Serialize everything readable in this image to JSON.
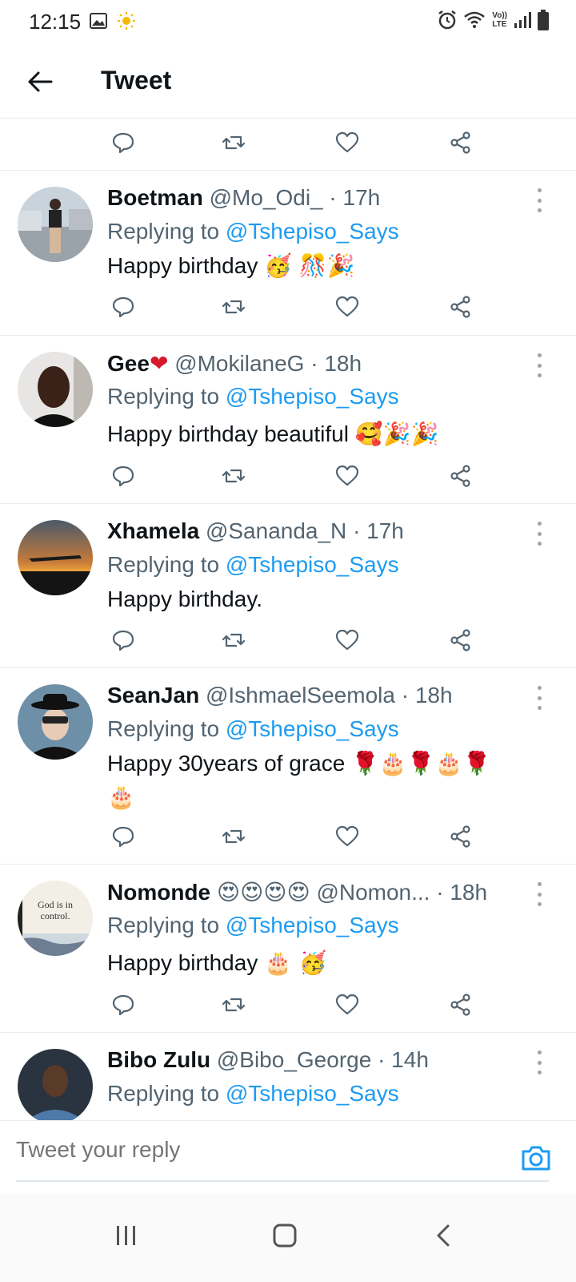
{
  "status_bar": {
    "time": "12:15",
    "left_icons": [
      "gallery-icon",
      "sun-icon"
    ],
    "right_icons": [
      "alarm-icon",
      "wifi-icon",
      "volte-icon",
      "signal-icon",
      "battery-icon"
    ],
    "volte_label_top": "Vo))",
    "volte_label_bottom": "LTE"
  },
  "header": {
    "title": "Tweet"
  },
  "tweets": [
    {
      "name": "Boetman",
      "handle": "@Mo_Odi_",
      "time": "· 17h",
      "replying_prefix": "Replying to",
      "replying_to": "@Tshepiso_Says",
      "text": "Happy birthday",
      "emoji": "🥳 🎊🎉"
    },
    {
      "name": "Gee",
      "name_emoji": "❤",
      "handle": "@MokilaneG",
      "time": "· 18h",
      "replying_prefix": "Replying to",
      "replying_to": "@Tshepiso_Says",
      "text": "Happy birthday beautiful",
      "emoji": "🥰🎉🎉"
    },
    {
      "name": "Xhamela",
      "handle": "@Sananda_N",
      "time": "· 17h",
      "replying_prefix": "Replying to",
      "replying_to": "@Tshepiso_Says",
      "text": "Happy birthday.",
      "emoji": ""
    },
    {
      "name": "SeanJan",
      "handle": "@IshmaelSeemola",
      "time": "· 18h",
      "replying_prefix": "Replying to",
      "replying_to": "@Tshepiso_Says",
      "text": "Happy 30years of grace",
      "emoji": "🌹🎂🌹🎂🌹",
      "emoji_line2": "🎂"
    },
    {
      "name": "Nomonde",
      "name_emoji": "😍😍😍😍",
      "handle": "@Nomon...",
      "time": "· 18h",
      "replying_prefix": "Replying to",
      "replying_to": "@Tshepiso_Says",
      "text": "Happy birthday",
      "emoji": "🎂 🥳",
      "avatar_text": "God is in control."
    },
    {
      "name": "Bibo Zulu",
      "handle": "@Bibo_George",
      "time": "· 14h",
      "replying_prefix": "Replying to",
      "replying_to": "@Tshepiso_Says"
    }
  ],
  "reply_bar": {
    "placeholder": "Tweet your reply"
  },
  "colors": {
    "accent": "#1d9bf0",
    "secondary_text": "#536471",
    "divider": "#e6ecf0",
    "heart": "#d61a2b"
  }
}
